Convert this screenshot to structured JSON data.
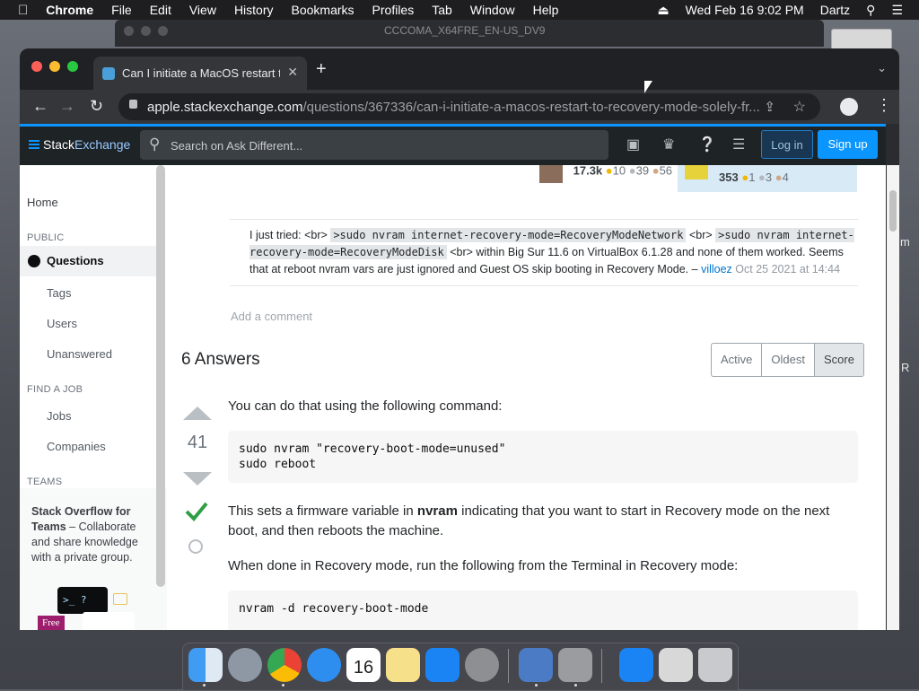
{
  "menubar": {
    "app": "Chrome",
    "items": [
      "File",
      "Edit",
      "View",
      "History",
      "Bookmarks",
      "Profiles",
      "Tab",
      "Window",
      "Help"
    ],
    "datetime": "Wed Feb 16  9:02 PM",
    "user": "Dartz"
  },
  "background_window": {
    "title": "CCCOMA_X64FRE_EN-US_DV9"
  },
  "browser": {
    "tab_title": "Can I initiate a MacOS restart t",
    "url_host": "apple.stackexchange.com",
    "url_path": "/questions/367336/can-i-initiate-a-macos-restart-to-recovery-mode-solely-fr..."
  },
  "site_header": {
    "logo_part1": "Stack",
    "logo_part2": "Exchange",
    "search_placeholder": "Search on Ask Different...",
    "login": "Log in",
    "signup": "Sign up"
  },
  "leftnav": {
    "home": "Home",
    "public_heading": "PUBLIC",
    "questions": "Questions",
    "tags": "Tags",
    "users": "Users",
    "unanswered": "Unanswered",
    "find_job_heading": "FIND A JOB",
    "jobs": "Jobs",
    "companies": "Companies",
    "teams_heading": "TEAMS",
    "teams_title": "Stack Overflow for Teams",
    "teams_text": " – Collaborate and share knowledge with a private group.",
    "terminal_text": ">_",
    "terminal_q": "?",
    "free_badge": "Free"
  },
  "user_cards": [
    {
      "rep": "17.3k",
      "gold": "10",
      "silver": "39",
      "bronze": "56"
    },
    {
      "rep": "353",
      "gold": "1",
      "silver": "3",
      "bronze": "4"
    }
  ],
  "comment": {
    "t1": "I just tried: <br> ",
    "c1": ">sudo nvram internet-recovery-mode=RecoveryModeNetwork",
    "t2": " <br> ",
    "c2": ">sudo nvram internet-recovery-mode=RecoveryModeDisk",
    "t3": " <br> within Big Sur 11.6 on VirtualBox 6.1.28 and none of them worked. Seems that at reboot nvram vars are just ignored and Guest OS skip booting in Recovery Mode.",
    "dash": " – ",
    "author": "villoez",
    "date": "Oct 25 2021 at 14:44"
  },
  "add_comment": "Add a comment",
  "answers": {
    "count_label": "6 Answers",
    "sort_options": [
      "Active",
      "Oldest",
      "Score"
    ],
    "active_sort": "Score"
  },
  "answer": {
    "score": "41",
    "p1": "You can do that using the following command:",
    "code1": "sudo nvram \"recovery-boot-mode=unused\"\nsudo reboot",
    "p2_a": "This sets a firmware variable in ",
    "p2_b": "nvram",
    "p2_c": " indicating that you want to start in Recovery mode on the next boot, and then reboots the machine.",
    "p3": "When done in Recovery mode, run the following from the Terminal in Recovery mode:",
    "code2": "nvram -d recovery-boot-mode"
  },
  "dock_apps": [
    "Finder",
    "Launchpad",
    "Chrome",
    "Safari",
    "Calendar",
    "Notes",
    "App Store",
    "System Preferences",
    "VirtualBox",
    "Disk Utility",
    "App Store",
    "Documents",
    "Trash"
  ],
  "calendar_day": "16",
  "colors": {
    "accent": "#0a95ff",
    "nav_active_bar": "#f48225",
    "accepted": "#2f9e44"
  }
}
